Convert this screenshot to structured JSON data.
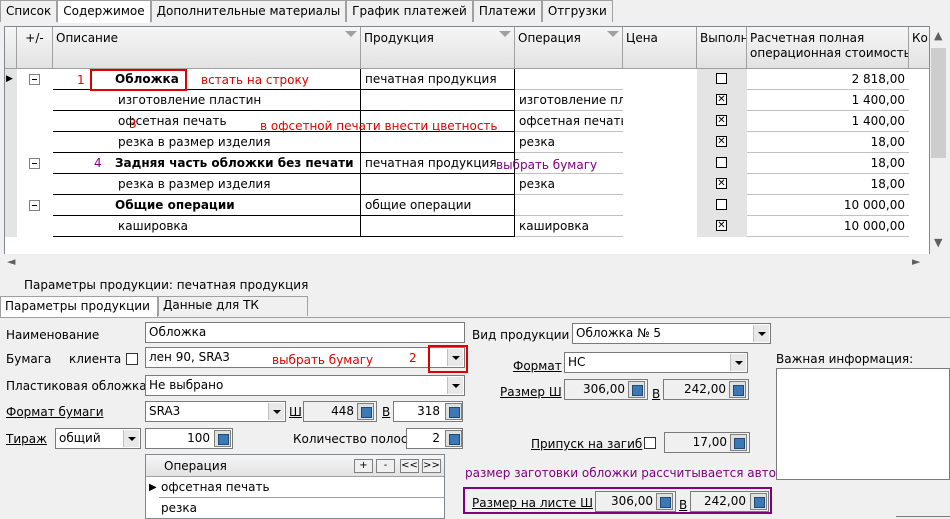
{
  "tabs": [
    "Список",
    "Содержимое",
    "Дополнительные материалы",
    "График платежей",
    "Платежи",
    "Отгрузки"
  ],
  "grid": {
    "headers": {
      "expand": "+/-",
      "desc": "Описание",
      "product": "Продукция",
      "operation": "Операция",
      "price": "Цена",
      "done": "Выполн",
      "cost_line1": "Расчетная полная",
      "cost_line2": "операционная стоимость",
      "extra": "Ко"
    },
    "rows": [
      {
        "n": "1",
        "desc": "Обложка",
        "product": "печатная продукция",
        "operation": "",
        "done": false,
        "cost": "2 818,00",
        "bold": true,
        "group": true
      },
      {
        "n": "",
        "desc": "изготовление пластин",
        "product": "",
        "operation": "изготовление плас",
        "done": true,
        "cost": "1 400,00",
        "bold": false,
        "group": false
      },
      {
        "n": "3",
        "desc": "офсетная печать",
        "product": "",
        "operation": "офсетная печать",
        "done": true,
        "cost": "1 400,00",
        "bold": false,
        "group": false
      },
      {
        "n": "",
        "desc": "резка в размер изделия",
        "product": "",
        "operation": "резка",
        "done": true,
        "cost": "18,00",
        "bold": false,
        "group": false
      },
      {
        "n": "4",
        "desc": "Задняя часть обложки без печати",
        "product": "печатная продукция",
        "operation": "",
        "done": false,
        "cost": "18,00",
        "bold": true,
        "group": true
      },
      {
        "n": "",
        "desc": "резка в размер изделия",
        "product": "",
        "operation": "резка",
        "done": true,
        "cost": "18,00",
        "bold": false,
        "group": false
      },
      {
        "n": "",
        "desc": "Общие операции",
        "product": "общие операции",
        "operation": "",
        "done": false,
        "cost": "10 000,00",
        "bold": true,
        "group": true
      },
      {
        "n": "",
        "desc": "кашировка",
        "product": "",
        "operation": "кашировка",
        "done": true,
        "cost": "10 000,00",
        "bold": false,
        "group": false
      }
    ]
  },
  "annotations": {
    "a1": "встать на строку",
    "a3": "в офсетной печати внести цветность",
    "a4": "выбрать бумагу",
    "a_paper": "выбрать бумагу",
    "n2": "2",
    "auto": "размер заготовки обложки рассчитывается автоматически"
  },
  "params": {
    "title": "Параметры продукции: печатная продукция",
    "tab1": "Параметры продукции",
    "tab2": "Данные для ТК",
    "name_label": "Наименование",
    "name_value": "Обложка",
    "paper_label": "Бумага",
    "client_label": "клиента",
    "paper_value": "лен 90, SRA3",
    "plastic_label": "Пластиковая обложка",
    "plastic_value": "Не выбрано",
    "format_label": "Формат бумаги",
    "format_value": "SRA3",
    "w_label": "Ш",
    "w_value": "448",
    "h_label": "В",
    "h_value": "318",
    "run_label": "Тираж",
    "run_type": "общий",
    "run_value": "100",
    "strips_label": "Количество полос",
    "strips_value": "2",
    "ops_header": "Операция",
    "ops": [
      "офсетная печать",
      "резка"
    ],
    "btn_plus": "+",
    "btn_minus": "-",
    "btn_prev": "<<",
    "btn_next": ">>",
    "kind_label": "Вид продукции",
    "kind_value": "Обложка № 5",
    "fmt_label": "Формат",
    "fmt_value": "НС",
    "size_label": "Размер Ш",
    "size_w": "306,00",
    "size_h_label": "В",
    "size_h": "242,00",
    "fold_label": "Припуск на загиб",
    "fold_value": "17,00",
    "sheet_label": "Размер на листе Ш",
    "sheet_w": "306,00",
    "sheet_h_label": "В",
    "sheet_h": "242,00",
    "important_label": "Важная информация:"
  },
  "colors": {
    "annotation_red": "#e00000",
    "annotation_purple": "#800080"
  }
}
